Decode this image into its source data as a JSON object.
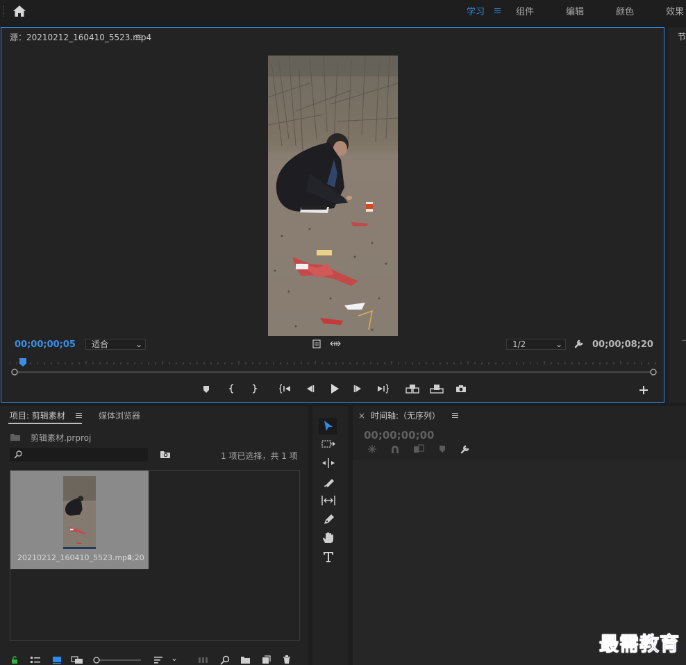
{
  "topbar": {
    "workspaces": [
      "学习",
      "组件",
      "编辑",
      "颜色",
      "效果"
    ],
    "active_workspace": "学习"
  },
  "source_monitor": {
    "title": "源：20210212_160410_5523.mp4",
    "timecode_current": "00;00;00;05",
    "zoom_value": "适合",
    "resolution_value": "1/2",
    "timecode_duration": "00;00;08;20"
  },
  "right_panel": {
    "title_fragment": "节"
  },
  "project": {
    "tab_project": "项目: 剪辑素材",
    "tab_media_browser": "媒体浏览器",
    "project_file": "剪辑素材.prproj",
    "selection_status": "1 项已选择，共 1 项",
    "search_placeholder": "",
    "clip": {
      "name": "20210212_160410_5523.mp4",
      "duration": "8;20"
    }
  },
  "timeline": {
    "title": "时间轴:（无序列）",
    "timecode": "00;00;00;00"
  },
  "watermark": {
    "text": "最需教育"
  },
  "colors": {
    "accent": "#2d8ceb",
    "panel_bg": "#232323",
    "app_bg": "#1d1d1d"
  },
  "icons": [
    "home-icon",
    "hamburger-menu-icon",
    "export-frame-icon",
    "settings-wrench-icon",
    "add-marker-icon",
    "mark-in-icon",
    "mark-out-icon",
    "go-to-in-icon",
    "step-back-icon",
    "play-icon",
    "step-forward-icon",
    "go-to-out-icon",
    "insert-icon",
    "overwrite-icon",
    "camera-icon",
    "plus-icon",
    "selection-tool-icon",
    "track-select-icon",
    "ripple-edit-icon",
    "razor-icon",
    "slip-icon",
    "pen-icon",
    "hand-icon",
    "type-icon"
  ]
}
